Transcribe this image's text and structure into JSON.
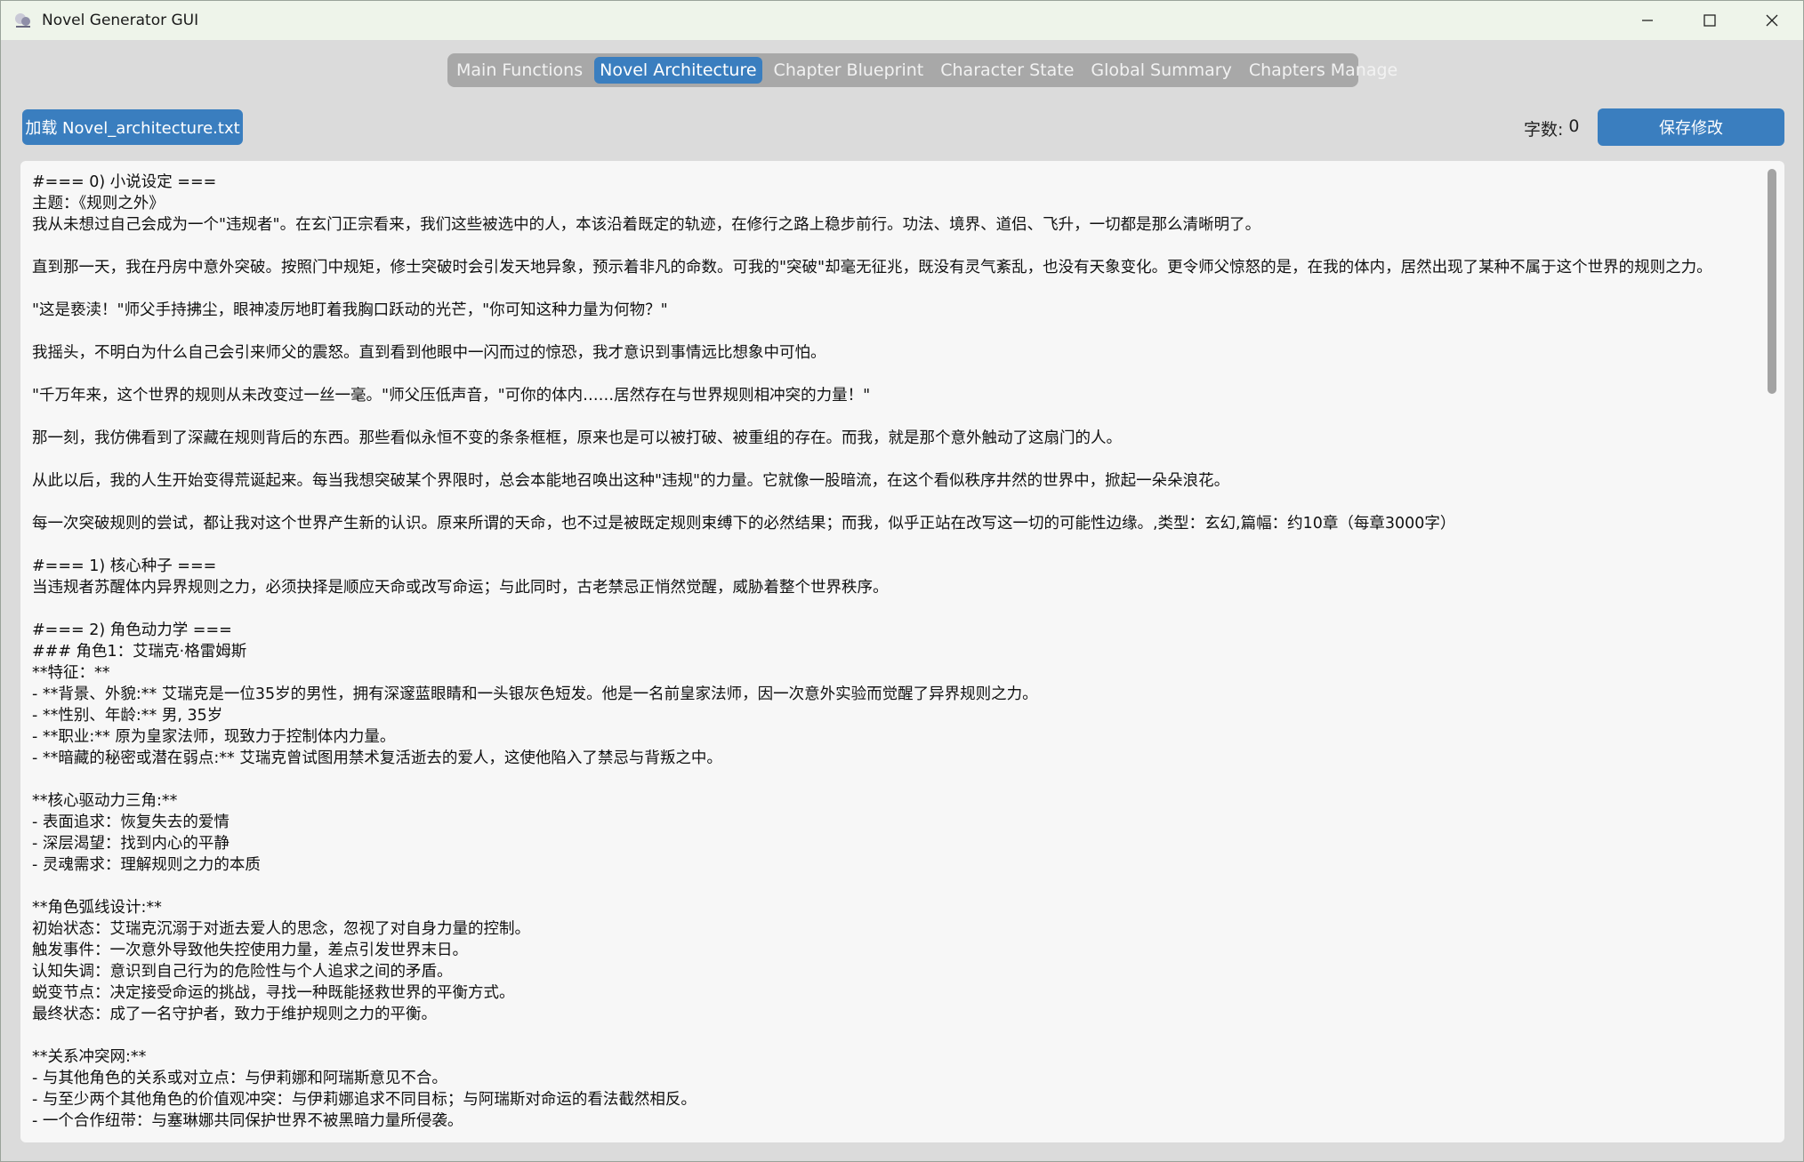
{
  "window": {
    "title": "Novel Generator GUI"
  },
  "tabs": [
    {
      "label": "Main Functions",
      "active": false
    },
    {
      "label": "Novel Architecture",
      "active": true
    },
    {
      "label": "Chapter Blueprint",
      "active": false
    },
    {
      "label": "Character State",
      "active": false
    },
    {
      "label": "Global Summary",
      "active": false
    },
    {
      "label": "Chapters Manage",
      "active": false
    }
  ],
  "toolbar": {
    "load_label": "加载 Novel_architecture.txt",
    "wordcount_label": "字数:",
    "wordcount_value": "0",
    "save_label": "保存修改"
  },
  "editor": {
    "lines": [
      "#=== 0) 小说设定 ===",
      "主题：《规则之外》",
      "我从未想过自己会成为一个\"违规者\"。在玄门正宗看来，我们这些被选中的人，本该沿着既定的轨迹，在修行之路上稳步前行。功法、境界、道侣、飞升，一切都是那么清晰明了。",
      "",
      "直到那一天，我在丹房中意外突破。按照门中规矩，修士突破时会引发天地异象，预示着非凡的命数。可我的\"突破\"却毫无征兆，既没有灵气紊乱，也没有天象变化。更令师父惊怒的是，在我的体内，居然出现了某种不属于这个世界的规则之力。",
      "",
      "\"这是亵渎！\"师父手持拂尘，眼神凌厉地盯着我胸口跃动的光芒，\"你可知这种力量为何物？\"",
      "",
      "我摇头，不明白为什么自己会引来师父的震怒。直到看到他眼中一闪而过的惊恐，我才意识到事情远比想象中可怕。",
      "",
      "\"千万年来，这个世界的规则从未改变过一丝一毫。\"师父压低声音，\"可你的体内……居然存在与世界规则相冲突的力量！\"",
      "",
      "那一刻，我仿佛看到了深藏在规则背后的东西。那些看似永恒不变的条条框框，原来也是可以被打破、被重组的存在。而我，就是那个意外触动了这扇门的人。",
      "",
      "从此以后，我的人生开始变得荒诞起来。每当我想突破某个界限时，总会本能地召唤出这种\"违规\"的力量。它就像一股暗流，在这个看似秩序井然的世界中，掀起一朵朵浪花。",
      "",
      "每一次突破规则的尝试，都让我对这个世界产生新的认识。原来所谓的天命，也不过是被既定规则束缚下的必然结果；而我，似乎正站在改写这一切的可能性边缘。,类型：玄幻,篇幅：约10章（每章3000字）",
      "",
      "#=== 1) 核心种子 ===",
      "当违规者苏醒体内异界规则之力，必须抉择是顺应天命或改写命运；与此同时，古老禁忌正悄然觉醒，威胁着整个世界秩序。",
      "",
      "#=== 2) 角色动力学 ===",
      "### 角色1：艾瑞克·格雷姆斯",
      "**特征：**",
      "- **背景、外貌:** 艾瑞克是一位35岁的男性，拥有深邃蓝眼睛和一头银灰色短发。他是一名前皇家法师，因一次意外实验而觉醒了异界规则之力。",
      "- **性别、年龄:** 男, 35岁",
      "- **职业:** 原为皇家法师，现致力于控制体内力量。",
      "- **暗藏的秘密或潜在弱点:** 艾瑞克曾试图用禁术复活逝去的爱人，这使他陷入了禁忌与背叛之中。",
      "",
      "**核心驱动力三角:**",
      "- 表面追求：恢复失去的爱情",
      "- 深层渴望：找到内心的平静",
      "- 灵魂需求：理解规则之力的本质",
      "",
      "**角色弧线设计:**",
      "初始状态：艾瑞克沉溺于对逝去爱人的思念，忽视了对自身力量的控制。",
      "触发事件：一次意外导致他失控使用力量，差点引发世界末日。",
      "认知失调：意识到自己行为的危险性与个人追求之间的矛盾。",
      "蜕变节点：决定接受命运的挑战，寻找一种既能拯救世界的平衡方式。",
      "最终状态：成了一名守护者，致力于维护规则之力的平衡。",
      "",
      "**关系冲突网:**",
      "- 与其他角色的关系或对立点：与伊莉娜和阿瑞斯意见不合。",
      "- 与至少两个其他角色的价值观冲突：与伊莉娜追求不同目标；与阿瑞斯对命运的看法截然相反。",
      "- 一个合作纽带：与塞琳娜共同保护世界不被黑暗力量所侵袭。"
    ]
  }
}
